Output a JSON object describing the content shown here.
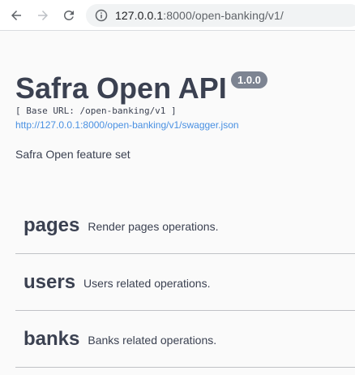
{
  "browser": {
    "url_host": "127.0.0.1",
    "url_path": ":8000/open-banking/v1/"
  },
  "info": {
    "title": "Safra Open API",
    "version": "1.0.0",
    "base_url": "[ Base URL: /open-banking/v1 ]",
    "spec_link": "http://127.0.0.1:8000/open-banking/v1/swagger.json",
    "description": "Safra Open feature set"
  },
  "tags": [
    {
      "name": "pages",
      "description": "Render pages operations."
    },
    {
      "name": "users",
      "description": "Users related operations."
    },
    {
      "name": "banks",
      "description": "Banks related operations."
    }
  ],
  "colors": {
    "text": "#3b4151",
    "link": "#4990e2",
    "version_badge": "#7d8492"
  },
  "icons": [
    "back-arrow-icon",
    "forward-arrow-icon",
    "reload-icon",
    "info-icon"
  ]
}
